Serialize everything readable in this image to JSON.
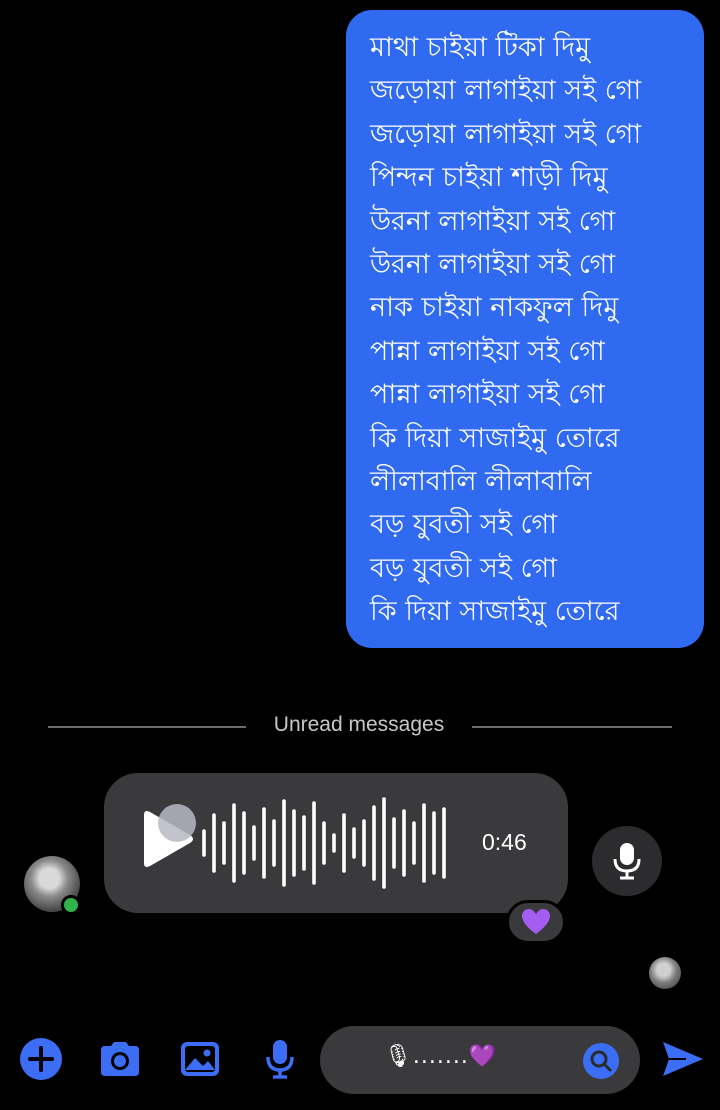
{
  "message": {
    "lines": [
      "মাথা চাইয়া টিকা দিমু",
      "জড়োয়া লাগাইয়া সই গো",
      "জড়োয়া লাগাইয়া সই গো",
      "পিন্দন চাইয়া শাড়ী দিমু",
      "উরনা লাগাইয়া সই গো",
      "উরনা লাগাইয়া সই গো",
      "নাক চাইয়া নাকফুল দিমু",
      "পান্না লাগাইয়া সই গো",
      "পান্না লাগাইয়া সই গো",
      "কি দিয়া সাজাইমু তোরে",
      "লীলাবালি লীলাবালি",
      "বড় যুবতী সই গো",
      "বড় যুবতী সই গো",
      "কি দিয়া সাজাইমু তোরে"
    ],
    "bubble_color": "#2f6af0"
  },
  "divider": {
    "label": "Unread messages"
  },
  "voice_message": {
    "duration": "0:46",
    "play_icon": "play-icon",
    "reaction_icon": "purple-heart-icon"
  },
  "composer": {
    "text": "🎙.......💜",
    "icons": [
      "plus-icon",
      "camera-icon",
      "image-icon",
      "microphone-icon",
      "search-icon",
      "send-icon"
    ]
  },
  "colors": {
    "accent": "#3b6ef5",
    "background": "#000000",
    "online": "#30b34a",
    "reaction": "#a55cf0"
  }
}
